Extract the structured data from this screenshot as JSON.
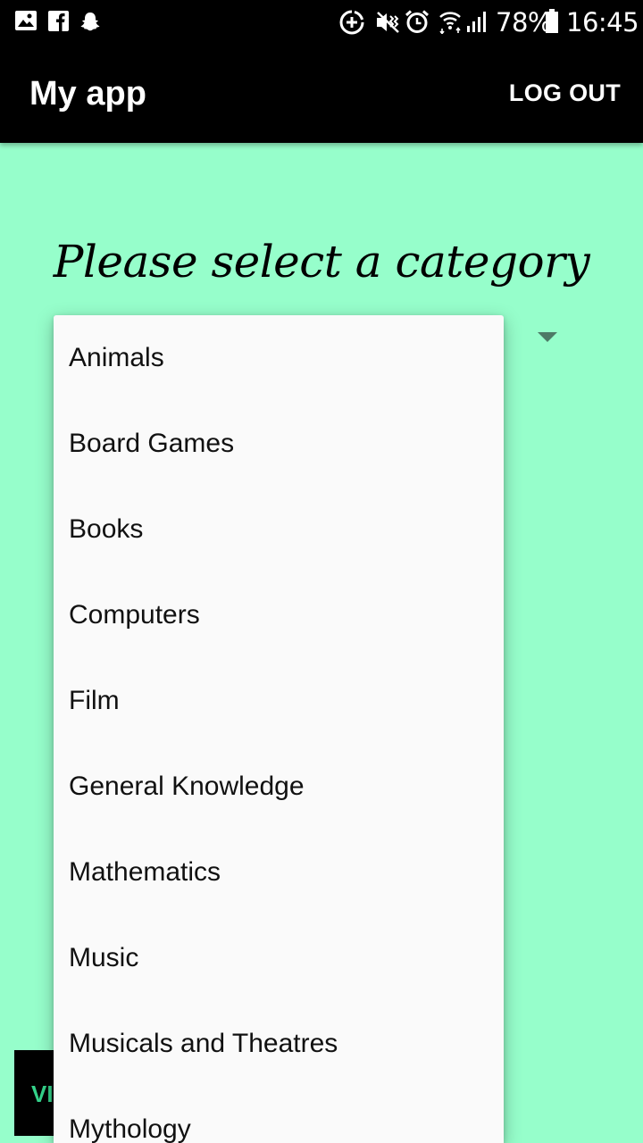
{
  "status_bar": {
    "battery": "78%",
    "time": "16:45",
    "icons": [
      "gallery-icon",
      "facebook-icon",
      "snapchat-icon",
      "data-saver-icon",
      "mute-vibrate-icon",
      "alarm-icon",
      "wifi-icon",
      "signal-icon",
      "battery-icon"
    ]
  },
  "app_bar": {
    "title": "My app",
    "logout_label": "LOG OUT"
  },
  "main": {
    "prompt": "Please select a category",
    "bottom_button_label": "VI"
  },
  "dropdown": {
    "items": [
      {
        "label": "Animals"
      },
      {
        "label": "Board Games"
      },
      {
        "label": "Books"
      },
      {
        "label": "Computers"
      },
      {
        "label": "Film"
      },
      {
        "label": "General Knowledge"
      },
      {
        "label": "Mathematics"
      },
      {
        "label": "Music"
      },
      {
        "label": "Musicals and Theatres"
      },
      {
        "label": "Mythology"
      }
    ]
  },
  "colors": {
    "background": "#96fecb",
    "app_bar": "#000000",
    "dropdown_bg": "#fafafa",
    "button_text": "#34d28a"
  }
}
